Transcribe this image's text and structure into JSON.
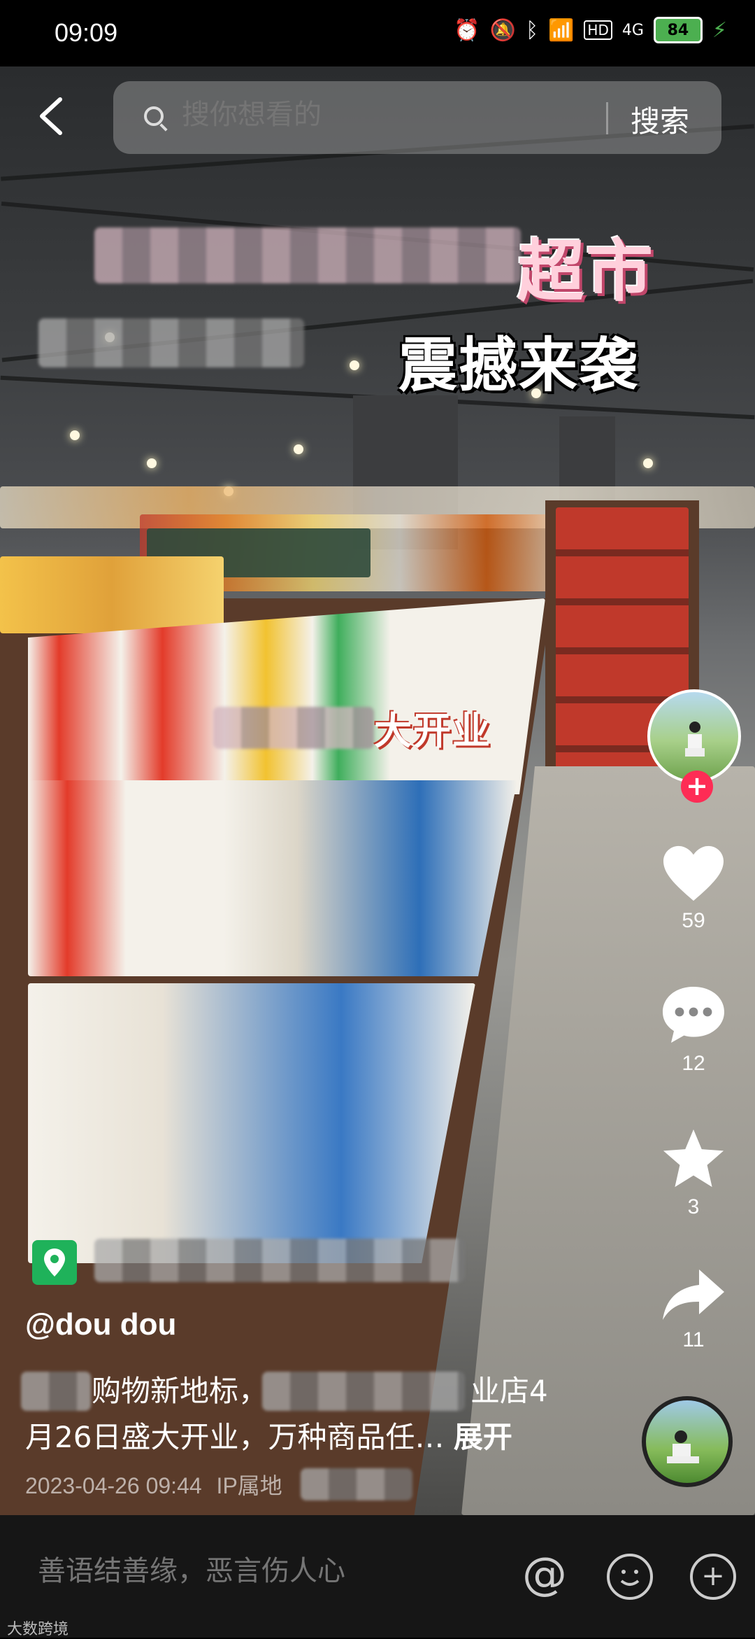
{
  "status_bar": {
    "time": "09:09",
    "network": "4G",
    "hd": "HD",
    "battery": "84"
  },
  "search": {
    "placeholder": "搜你想看的",
    "button": "搜索"
  },
  "video": {
    "overlay_title": "超市",
    "overlay_subtitle": "震撼来袭",
    "overlay_opening": "大开业"
  },
  "actions": {
    "likes": "59",
    "comments": "12",
    "favorites": "3",
    "shares": "11"
  },
  "post": {
    "username": "@dou  dou",
    "description_part1": "购物新地标，",
    "description_part2": "业店4月26日盛大开业，万种商品任…",
    "expand_label": "展开",
    "date": "2023-04-26 09:44",
    "ip_label": "IP属地"
  },
  "comment_bar": {
    "placeholder": "善语结善缘，恶言伤人心"
  },
  "watermark": "大数跨境",
  "colors": {
    "follow": "#fe2c55",
    "location": "#1fb25a",
    "title_pink": "#ffb6c8"
  }
}
